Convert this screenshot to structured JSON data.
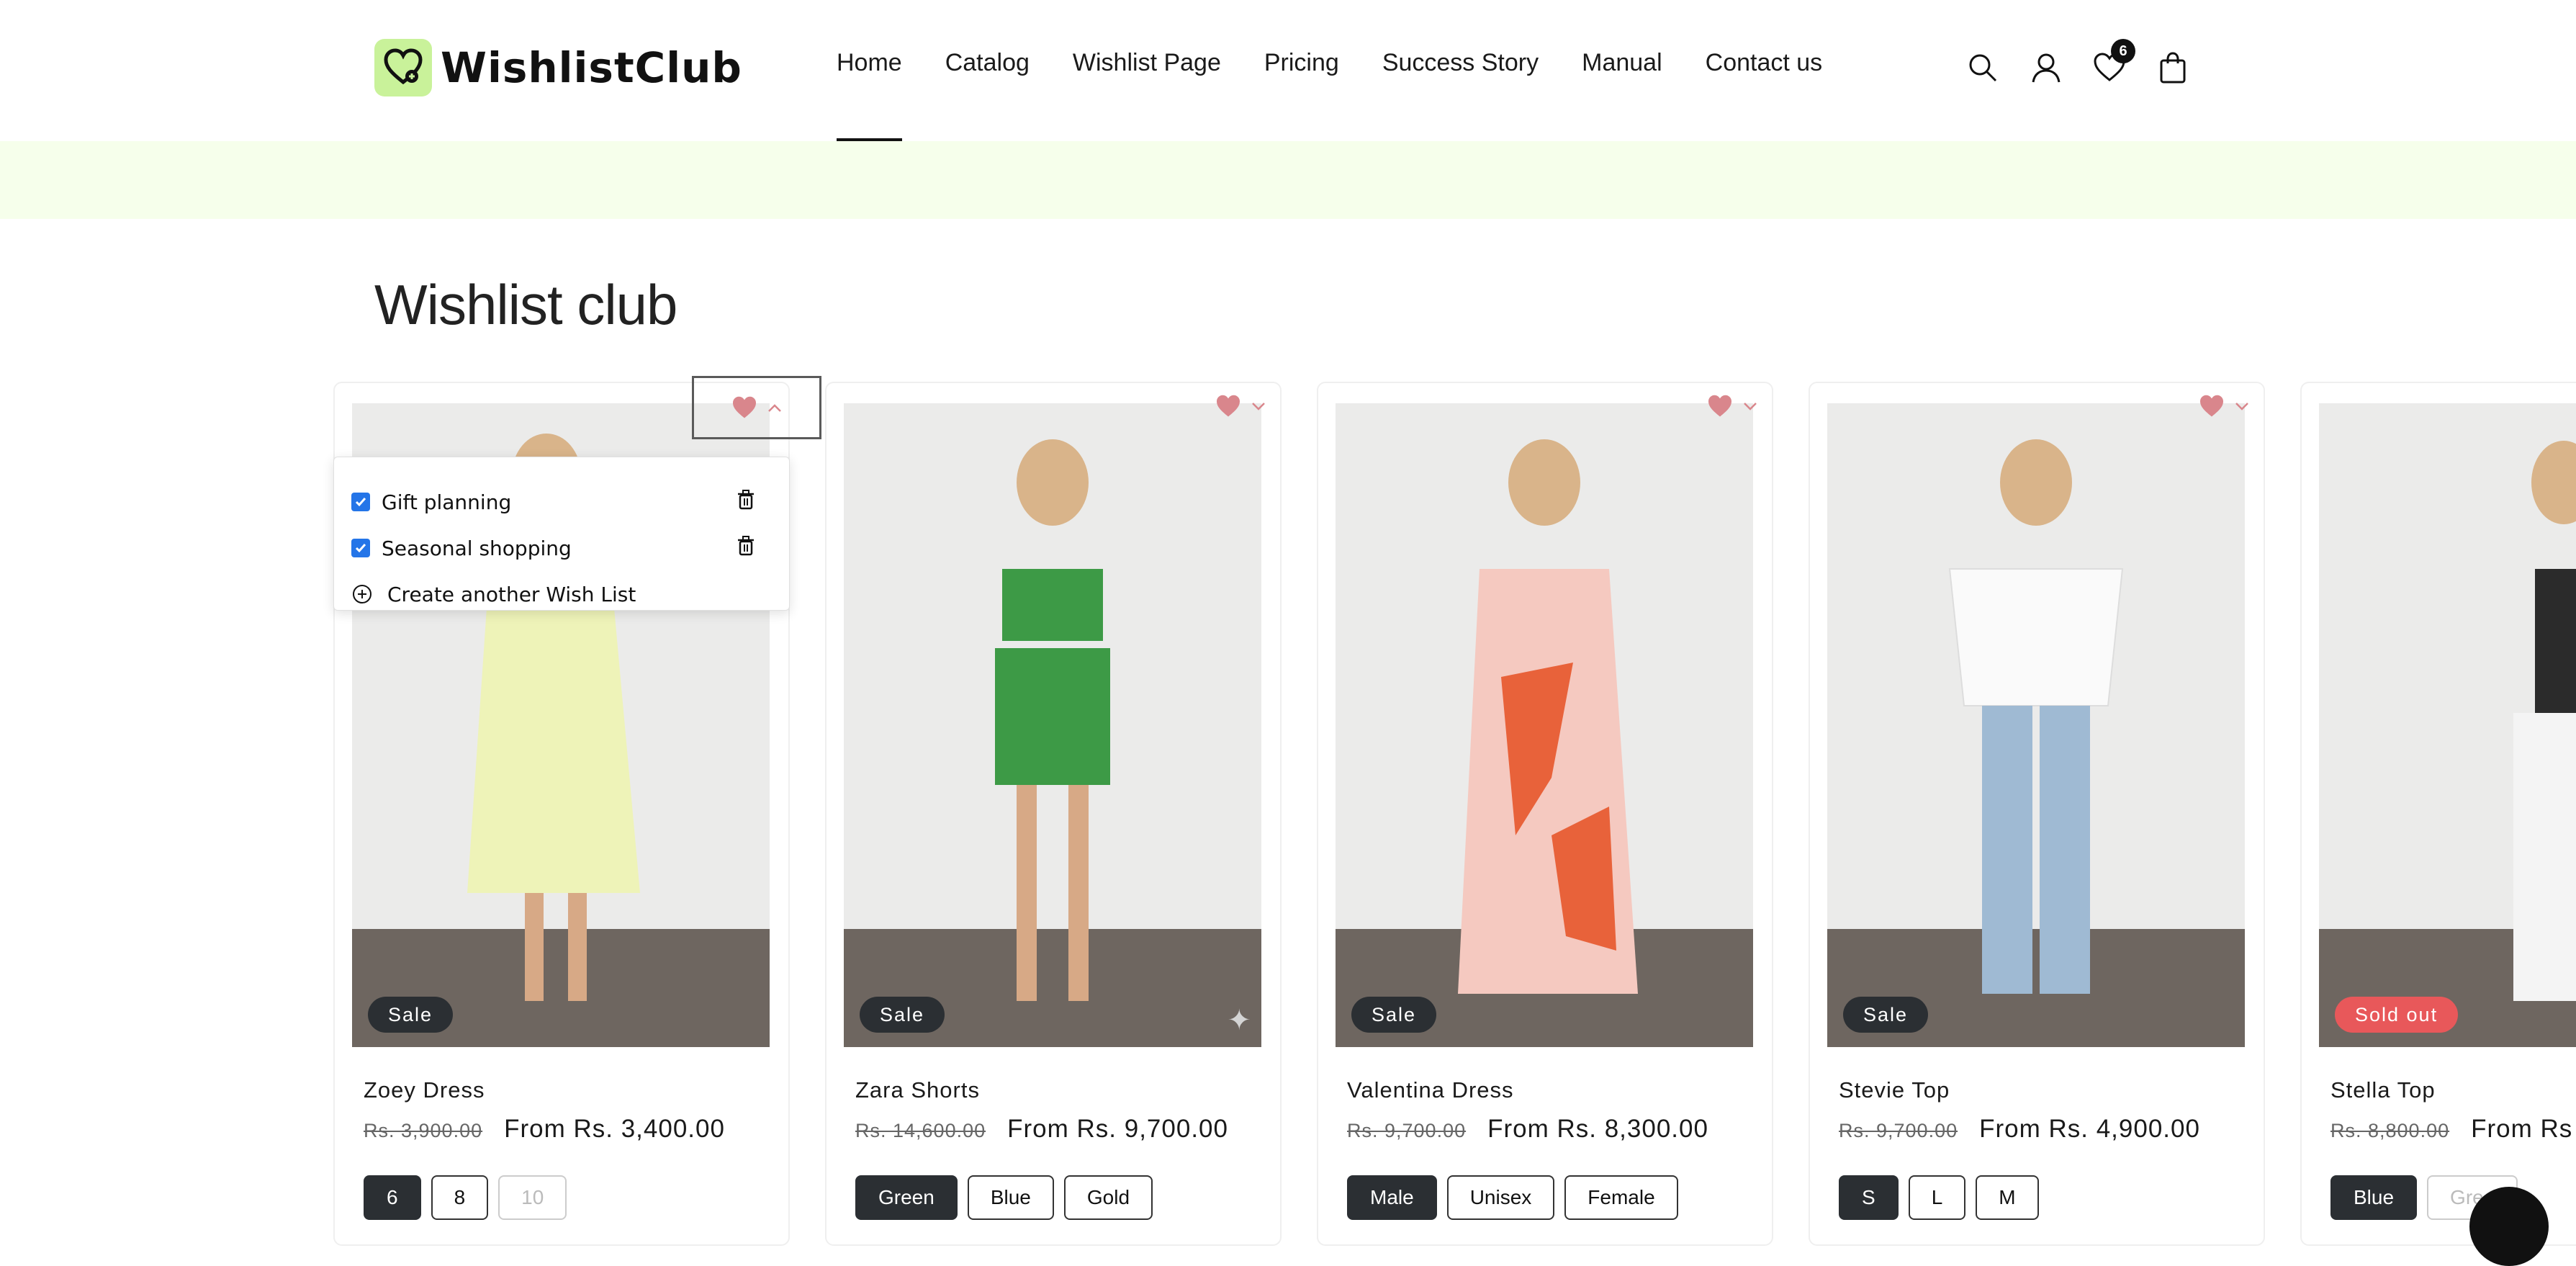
{
  "header": {
    "logo_text": "WishlistClub",
    "nav": [
      "Home",
      "Catalog",
      "Wishlist Page",
      "Pricing",
      "Success Story",
      "Manual",
      "Contact us"
    ],
    "wishlist_count": "6"
  },
  "section": {
    "title": "Wishlist club"
  },
  "products": [
    {
      "title": "Zoey Dress",
      "old_price": "Rs. 3,900.00",
      "price": "From Rs. 3,400.00",
      "badge": "Sale",
      "options": [
        "6",
        "8",
        "10"
      ]
    },
    {
      "title": "Zara Shorts",
      "old_price": "Rs. 14,600.00",
      "price": "From Rs. 9,700.00",
      "badge": "Sale",
      "options": [
        "Green",
        "Blue",
        "Gold"
      ]
    },
    {
      "title": "Valentina Dress",
      "old_price": "Rs. 9,700.00",
      "price": "From Rs. 8,300.00",
      "badge": "Sale",
      "options": [
        "Male",
        "Unisex",
        "Female"
      ]
    },
    {
      "title": "Stevie Top",
      "old_price": "Rs. 9,700.00",
      "price": "From Rs. 4,900.00",
      "badge": "Sale",
      "options": [
        "S",
        "L",
        "M"
      ]
    },
    {
      "title": "Stella Top",
      "old_price": "Rs. 8,800.00",
      "price": "From Rs",
      "badge": "Sold out",
      "options": [
        "Blue",
        "Gree"
      ]
    }
  ],
  "wishlist_dropdown": {
    "lists": [
      "Gift planning",
      "Seasonal shopping"
    ],
    "create_label": "Create another Wish List"
  },
  "colors": {
    "accent_bg": "#f6ffeb",
    "logo_green": "#c9f29a",
    "sold_out": "#e8585a",
    "heart": "#d9868c",
    "checkbox": "#2475e8"
  }
}
